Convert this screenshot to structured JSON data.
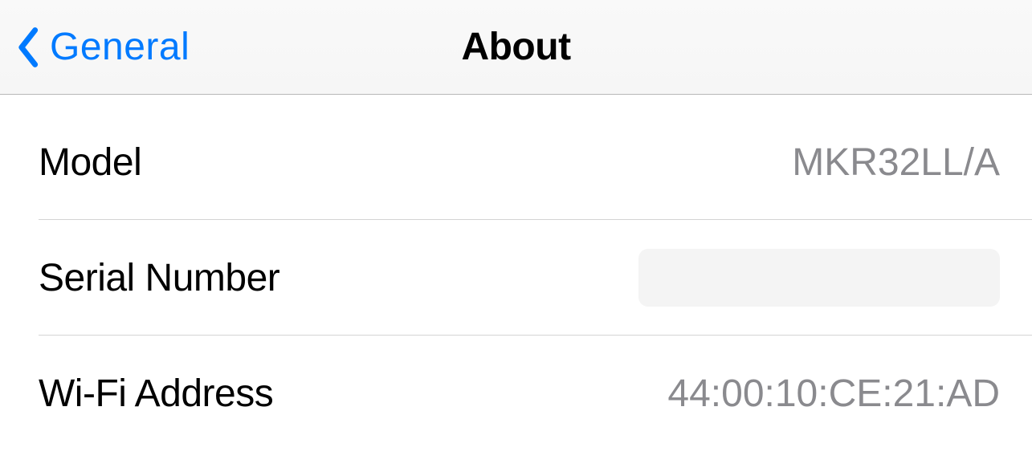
{
  "nav": {
    "back_label": "General",
    "title": "About"
  },
  "rows": [
    {
      "label": "Model",
      "value": "MKR32LL/A"
    },
    {
      "label": "Serial Number",
      "value": ""
    },
    {
      "label": "Wi-Fi Address",
      "value": "44:00:10:CE:21:AD"
    }
  ]
}
